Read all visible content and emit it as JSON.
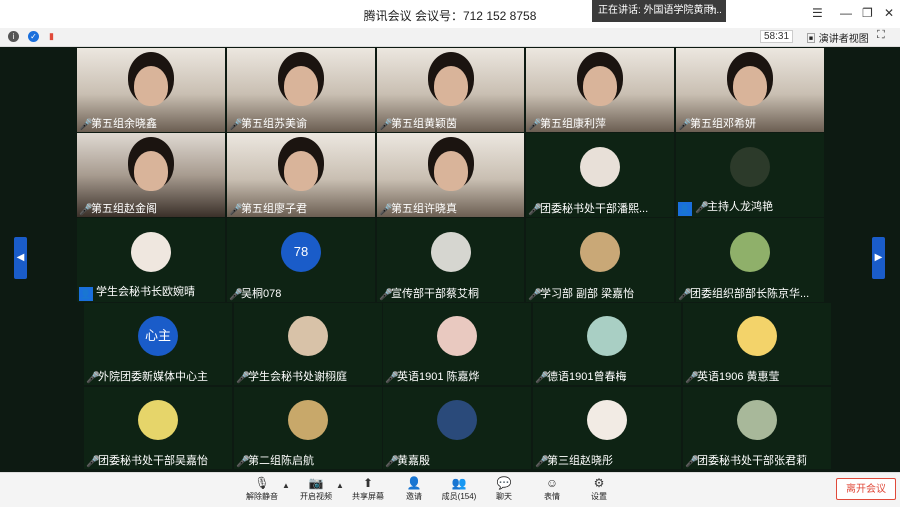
{
  "window": {
    "title": "腾讯会议 会议号：712 152 8758"
  },
  "speaking": {
    "text": "正在讲话: 外国语学院黄雨..."
  },
  "infobar": {
    "timer": "58:31",
    "view_label": "演讲者视图"
  },
  "participants": [
    {
      "name": "第五组余晓鑫"
    },
    {
      "name": "第五组苏美谕"
    },
    {
      "name": "第五组黄颖茵"
    },
    {
      "name": "第五组康利萍"
    },
    {
      "name": "第五组邓希妍"
    },
    {
      "name": "第五组赵金阁"
    },
    {
      "name": "第五组廖子君"
    },
    {
      "name": "第五组许晓真"
    },
    {
      "name": "团委秘书处干部潘熙..."
    },
    {
      "name": "主持人龙鸿艳"
    },
    {
      "name": "学生会秘书长欧婉晴"
    },
    {
      "name": "吴桐078",
      "avatar_text": "78"
    },
    {
      "name": "宣传部干部蔡艾桐"
    },
    {
      "name": "学习部 副部 梁嘉怡"
    },
    {
      "name": "团委组织部部长陈京华..."
    },
    {
      "name": "外院团委新媒体中心主",
      "avatar_text": "心主"
    },
    {
      "name": "学生会秘书处谢栩庭"
    },
    {
      "name": "英语1901 陈嘉烨"
    },
    {
      "name": "德语1901曾春梅"
    },
    {
      "name": "英语1906 黄惠莹"
    },
    {
      "name": "团委秘书处干部吴嘉怡"
    },
    {
      "name": "第二组陈启航"
    },
    {
      "name": "黄嘉殷"
    },
    {
      "name": "第三组赵晓彤"
    },
    {
      "name": "团委秘书处干部张君莉"
    }
  ],
  "toolbar": {
    "unmute": "解除静音",
    "video": "开启视频",
    "share": "共享屏幕",
    "invite": "邀请",
    "members": "成员(154)",
    "chat": "聊天",
    "reactions": "表情",
    "settings": "设置",
    "leave": "离开会议"
  },
  "colors": {
    "accent": "#1a5cc9",
    "leave": "#e04a3a",
    "grid_bg": "#0d1a12"
  }
}
